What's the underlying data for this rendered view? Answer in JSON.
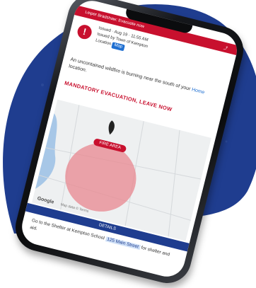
{
  "alert_bar": {
    "text": "Leiper Bradshaw: Evacuate now",
    "icon": "share-icon"
  },
  "header": {
    "badge": "!",
    "line1": "Issued · Aug 19 · 11:55 AM",
    "line2": "Issued by Town of Kempton",
    "line3": "Location",
    "chip": "Map"
  },
  "message": {
    "text": "An uncontained wildfire is burning near the south of your",
    "link": "Home",
    "text2": "location."
  },
  "evacuation_title": "MANDATORY EVACUATION, LEAVE NOW",
  "map": {
    "pill": "FIRE AREA",
    "google": "Google",
    "footer": "Map data ©  Terms"
  },
  "separator": "DETAILS",
  "footer": {
    "text1": "Go to the Shelter at Kempton School",
    "highlight": "125 Main Street",
    "text2": "for shelter and aid."
  },
  "colors": {
    "primary_red": "#c8102e",
    "brand_blue": "#1f3d8f",
    "accent_blue": "#1f6fd1"
  }
}
